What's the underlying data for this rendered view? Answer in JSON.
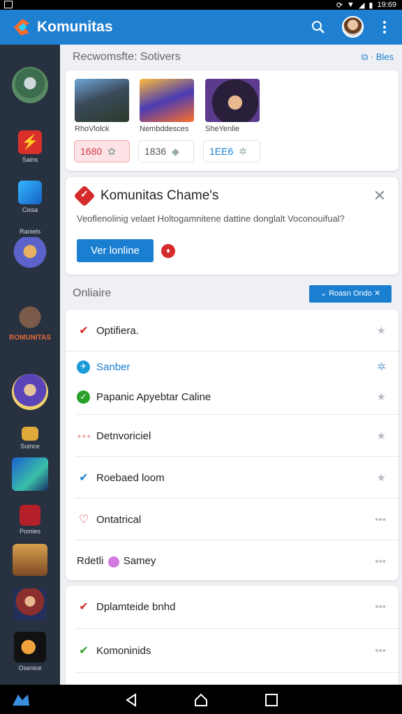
{
  "status_bar": {
    "time": "19:69"
  },
  "app_bar": {
    "title": "Komunitas",
    "search_icon": "search-icon",
    "menu_icon": "more-vert-icon"
  },
  "rail": {
    "items": [
      {
        "label": ""
      },
      {
        "label": "Sains"
      },
      {
        "label": "Cissa"
      },
      {
        "label": "Raniels"
      },
      {
        "label": "ROMUNITAS"
      },
      {
        "label": ""
      },
      {
        "label": "Suince"
      },
      {
        "label": ""
      },
      {
        "label": "Pomies"
      },
      {
        "label": ""
      },
      {
        "label": ""
      },
      {
        "label": "Osenice"
      }
    ]
  },
  "recommended": {
    "title": "Recwomsfte: Sotivers",
    "action": "Bles",
    "games": [
      {
        "name": "RhoVlolck"
      },
      {
        "name": "Nembddesces"
      },
      {
        "name": "SheYenlie"
      }
    ],
    "chips": [
      {
        "value": "1680"
      },
      {
        "value": "1836"
      },
      {
        "value": "1EE6"
      }
    ]
  },
  "promo": {
    "title": "Komunitas Chame's",
    "body": "Veoflenolinig velaet Holtogamnitene dattine donglalt Voconouifual?",
    "button": "Ver lonline",
    "close_icon": "close-icon"
  },
  "online": {
    "title": "Onliaire",
    "filter_button": "Roasn Ondo",
    "rows": [
      {
        "label": "Optifiera."
      },
      {
        "label": "Sanber"
      },
      {
        "label": "Papanic Apyebtar Caline"
      },
      {
        "label": "Detnvoriciel"
      },
      {
        "label": "Roebaed loom"
      },
      {
        "label": "Ontatrical"
      },
      {
        "label": "Rdetli",
        "extra": "Samey"
      }
    ],
    "rows2": [
      {
        "label": "Dplamteide bnhd"
      },
      {
        "label": "Komoninids"
      }
    ]
  },
  "colors": {
    "app_bar": "#1f7fd0",
    "rail": "#27313f",
    "accent_blue": "#1a7fd1",
    "check_red": "#d42a2a",
    "check_green": "#2aa02a"
  }
}
